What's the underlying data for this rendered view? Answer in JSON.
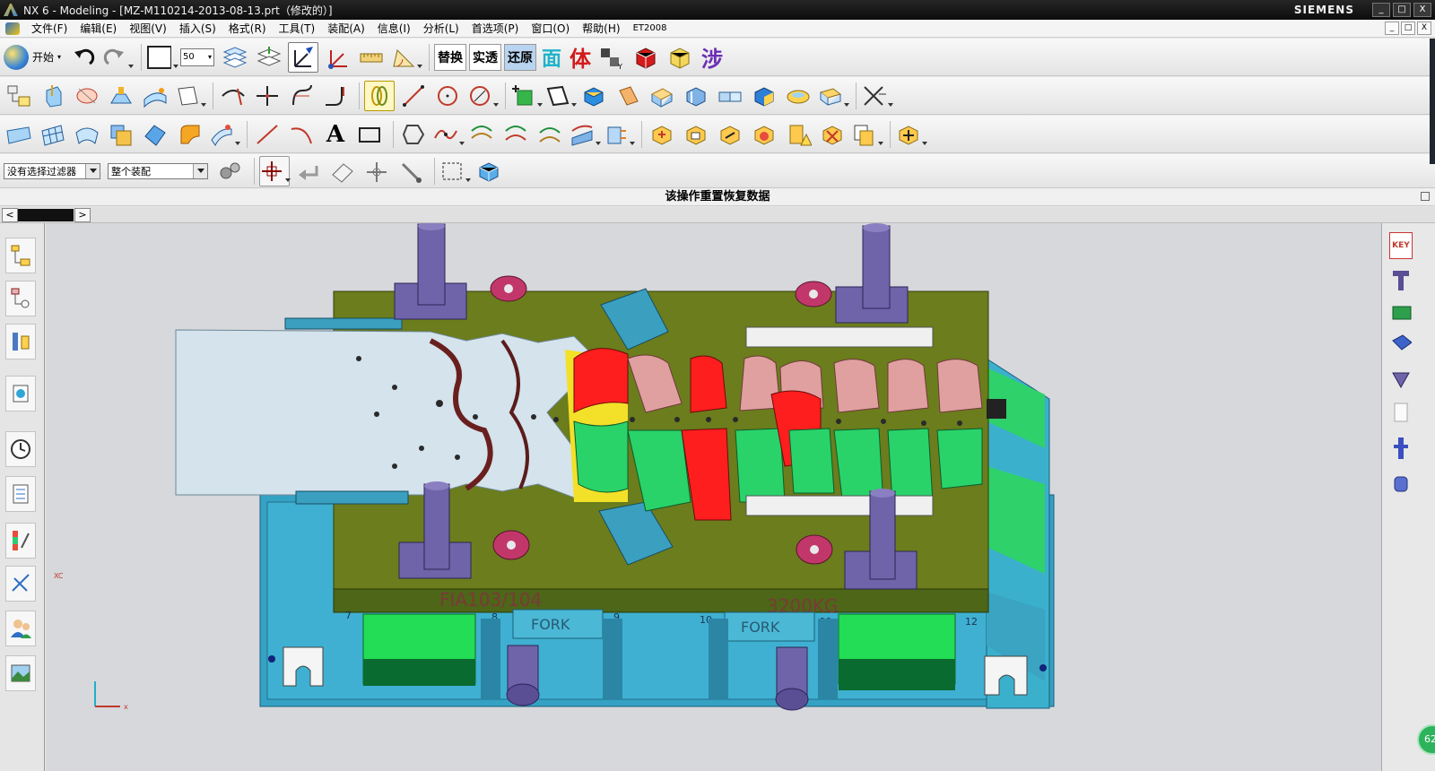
{
  "window": {
    "title": "NX 6 - Modeling - [MZ-M110214-2013-08-13.prt（修改的）]",
    "brand": "SIEMENS",
    "controls": [
      "_",
      "□",
      "X"
    ]
  },
  "menu": {
    "items": [
      "文件(F)",
      "编辑(E)",
      "视图(V)",
      "插入(S)",
      "格式(R)",
      "工具(T)",
      "装配(A)",
      "信息(I)",
      "分析(L)",
      "首选项(P)",
      "窗口(O)",
      "帮助(H)",
      "ET2008"
    ],
    "doc_controls": [
      "_",
      "□",
      "X"
    ]
  },
  "toolbar1": {
    "start_label": "开始",
    "zoom_value": "50",
    "text_buttons": [
      "替换",
      "实透",
      "还原",
      "面",
      "体"
    ],
    "steps_glyph": "涉"
  },
  "toolbar2": {
    "text_glyph": "A"
  },
  "selection": {
    "filter_value": "没有选择过滤器",
    "scope_value": "整个装配"
  },
  "cue_line": "该操作重置恢复数据",
  "nav": {
    "left": "<",
    "right": ">"
  },
  "model": {
    "engraving_left": "FIA103/104",
    "engraving_right": "3200KG",
    "fork_labels": [
      "FORK",
      "FORK"
    ],
    "slot_numbers": [
      "7",
      "8",
      "9",
      "10",
      "11",
      "12"
    ],
    "triad_x": "x",
    "axis_xc": "XC"
  },
  "rightbar": {
    "key_label": "KEY"
  },
  "badge": "62",
  "colors": {
    "titlebar": "#141414",
    "plate_olive": "#6b7d1c",
    "base_blue": "#35a2c4",
    "sheet": "#d4e3ec",
    "green": "#29d36a",
    "red": "#ff1e1e",
    "pink": "#e0a0a0",
    "pillar": "#6f63a9",
    "bushing": "#c2376a",
    "block_cyan": "#3b9fc0"
  }
}
